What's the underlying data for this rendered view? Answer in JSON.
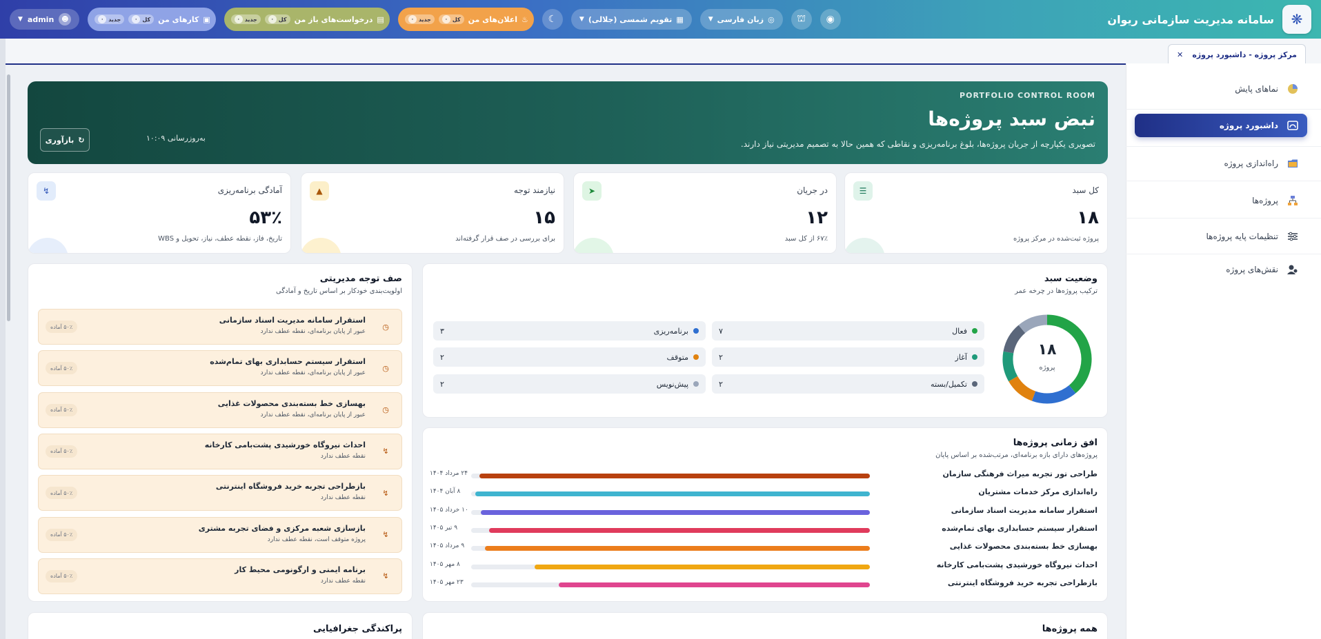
{
  "app": {
    "title": "سامانه مدیریت سازمانی ریوان"
  },
  "topbar": {
    "language": "زبان  فارسی",
    "calendar": "تقویم  شمسی (جلالی)",
    "announcements": {
      "label": "اعلان‌های من",
      "all": "کل",
      "new": "جدید"
    },
    "requests": {
      "label": "درخواست‌های باز من",
      "all": "کل",
      "new": "جدید"
    },
    "tasks": {
      "label": "کارهای من",
      "all": "کل",
      "new": "جدید"
    },
    "count_all": "۰",
    "count_new": "۰",
    "user": "admin"
  },
  "tab": {
    "label": "مرکز پروژه  -  داشبورد پروژه"
  },
  "sidebar": {
    "items": [
      {
        "label": "نماهای پایش",
        "icon": "pie-chart-icon"
      },
      {
        "label": "داشبورد پروژه",
        "icon": "dashboard-icon",
        "active": true
      },
      {
        "label": "راه‌اندازی پروژه",
        "icon": "folder-icon"
      },
      {
        "label": "پروژه‌ها",
        "icon": "hierarchy-icon"
      },
      {
        "label": "تنظیمات پایه پروژه‌ها",
        "icon": "sliders-icon"
      },
      {
        "label": "نقش‌های پروژه",
        "icon": "users-icon"
      }
    ]
  },
  "hero": {
    "kicker": "PORTFOLIO CONTROL ROOM",
    "title": "نبض سبد پروژه‌ها",
    "subtitle": "تصویری یکپارچه از جریان پروژه‌ها، بلوغ برنامه‌ریزی و نقاطی که همین حالا به تصمیم مدیریتی نیاز دارند.",
    "updated": "به‌روزرسانی ۱۰:۰۹",
    "refresh": "بازآوری"
  },
  "kpis": [
    {
      "label": "کل سبد",
      "value": "۱۸",
      "desc": "پروژه ثبت‌شده در مرکز پروژه",
      "icon": "layers-icon"
    },
    {
      "label": "در جریان",
      "value": "۱۲",
      "desc": "۶۷٪ از کل سبد",
      "icon": "running-icon"
    },
    {
      "label": "نیازمند توجه",
      "value": "۱۵",
      "desc": "برای بررسی در صف قرار گرفته‌اند",
      "icon": "warning-icon"
    },
    {
      "label": "آمادگی برنامه‌ریزی",
      "value": "۵۳٪",
      "desc": "تاریخ، فاز، نقطه عطف، نیاز، تحویل و WBS",
      "icon": "route-icon"
    }
  ],
  "status": {
    "title": "وضعیت سبد",
    "subtitle": "ترکیب پروژه‌ها در چرخه عمر",
    "total": "۱۸",
    "total_label": "پروژه",
    "items": [
      {
        "label": "فعال",
        "count": "۷",
        "color": "#22a447",
        "value": 7
      },
      {
        "label": "برنامه‌ریزی",
        "count": "۳",
        "color": "#2f6fd0",
        "value": 3
      },
      {
        "label": "آغاز",
        "count": "۲",
        "color": "#1f9a7a",
        "value": 2
      },
      {
        "label": "متوقف",
        "count": "۲",
        "color": "#e0820f",
        "value": 2
      },
      {
        "label": "تکمیل/بسته",
        "count": "۲",
        "color": "#5a667a",
        "value": 2
      },
      {
        "label": "پیش‌نویس",
        "count": "۲",
        "color": "#9aa6ba",
        "value": 2
      }
    ]
  },
  "queue": {
    "title": "صف توجه مدیریتی",
    "subtitle": "اولویت‌بندی خودکار بر اساس تاریخ و آمادگی",
    "items": [
      {
        "title": "استقرار سامانه مدیریت اسناد سازمانی",
        "sub": "عبور از پایان برنامه‌ای، نقطه عطف ندارد",
        "badge": "۵۰٪ آماده",
        "icon": "clock-icon"
      },
      {
        "title": "استقرار سیستم حسابداری بهای تمام‌شده",
        "sub": "عبور از پایان برنامه‌ای، نقطه عطف ندارد",
        "badge": "۵۰٪ آماده",
        "icon": "clock-icon"
      },
      {
        "title": "بهسازی خط بسته‌بندی محصولات غذایی",
        "sub": "عبور از پایان برنامه‌ای، نقطه عطف ندارد",
        "badge": "۵۰٪ آماده",
        "icon": "clock-icon"
      },
      {
        "title": "احداث نیروگاه خورشیدی پشت‌بامی کارخانه",
        "sub": "نقطه عطف ندارد",
        "badge": "۵۰٪ آماده",
        "icon": "route-icon"
      },
      {
        "title": "بازطراحی تجربه خرید فروشگاه اینترنتی",
        "sub": "نقطه عطف ندارد",
        "badge": "۵۰٪ آماده",
        "icon": "route-icon"
      },
      {
        "title": "بازسازی شعبه مرکزی و فضای تجربه مشتری",
        "sub": "پروژه متوقف است، نقطه عطف ندارد",
        "badge": "۵۰٪ آماده",
        "icon": "route-icon"
      },
      {
        "title": "برنامه ایمنی و ارگونومی محیط کار",
        "sub": "نقطه عطف ندارد",
        "badge": "۵۰٪ آماده",
        "icon": "route-icon"
      }
    ]
  },
  "timeline": {
    "title": "افق زمانی پروژه‌ها",
    "subtitle": "پروژه‌های دارای بازه برنامه‌ای، مرتب‌شده بر اساس پایان",
    "items": [
      {
        "name": "طراحی تور تجربه میراث فرهنگی سازمان",
        "date": "۲۴ مرداد ۱۴۰۴",
        "color": "#b8410f",
        "start": 0.0,
        "end": 0.98
      },
      {
        "name": "راه‌اندازی مرکز خدمات مشتریان",
        "date": "۸ آبان ۱۴۰۴",
        "color": "#3fb4cf",
        "start": 0.0,
        "end": 0.99
      },
      {
        "name": "استقرار سامانه مدیریت اسناد سازمانی",
        "date": "۱۰ خرداد ۱۴۰۵",
        "color": "#6a63dd",
        "start": 0.0,
        "end": 0.975
      },
      {
        "name": "استقرار سیستم حسابداری بهای تمام‌شده",
        "date": "۹ تیر ۱۴۰۵",
        "color": "#e03b5c",
        "start": 0.0,
        "end": 0.955
      },
      {
        "name": "بهسازی خط بسته‌بندی محصولات غذایی",
        "date": "۹ مرداد ۱۴۰۵",
        "color": "#ec7d1c",
        "start": 0.0,
        "end": 0.965
      },
      {
        "name": "احداث نیروگاه خورشیدی پشت‌بامی کارخانه",
        "date": "۸ مهر ۱۴۰۵",
        "color": "#f0a712",
        "start": 0.0,
        "end": 0.84
      },
      {
        "name": "بازطراحی تجربه خرید فروشگاه اینترنتی",
        "date": "۲۳ مهر ۱۴۰۵",
        "color": "#e0458f",
        "start": 0.0,
        "end": 0.78
      }
    ]
  },
  "geo": {
    "title": "پراکندگی جغرافیایی"
  },
  "all_projects": {
    "title": "همه پروژه‌ها"
  }
}
